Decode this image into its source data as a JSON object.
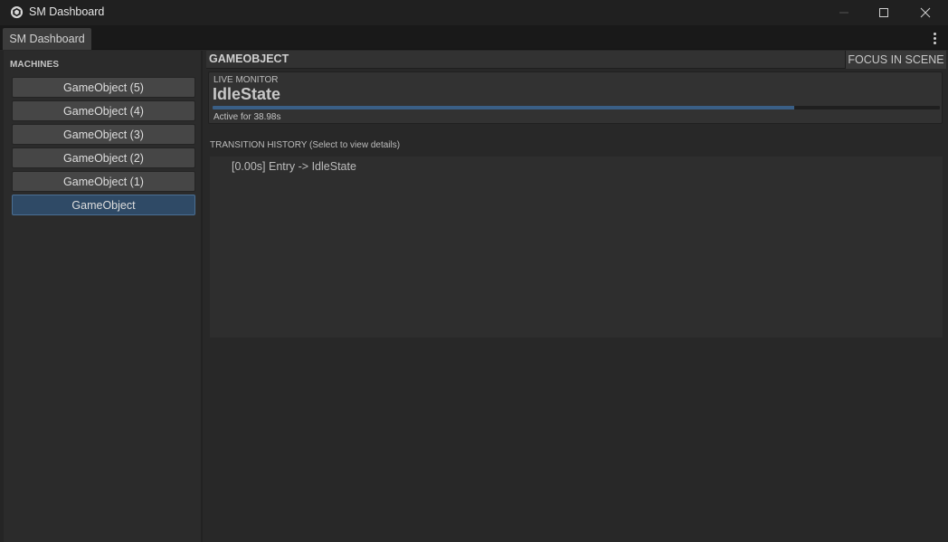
{
  "window": {
    "title": "SM Dashboard"
  },
  "tab": {
    "label": "SM Dashboard"
  },
  "sidebar": {
    "title": "MACHINES",
    "machines": [
      {
        "label": "GameObject (5)",
        "selected": false
      },
      {
        "label": "GameObject (4)",
        "selected": false
      },
      {
        "label": "GameObject (3)",
        "selected": false
      },
      {
        "label": "GameObject (2)",
        "selected": false
      },
      {
        "label": "GameObject (1)",
        "selected": false
      },
      {
        "label": "GameObject",
        "selected": true
      }
    ]
  },
  "main": {
    "header_title": "GAMEOBJECT",
    "focus_button": "FOCUS IN SCENE",
    "live_monitor": {
      "label": "LIVE MONITOR",
      "state": "IdleState",
      "progress_fraction": 0.8,
      "active_text": "Active for 38.98s"
    },
    "history": {
      "title": "TRANSITION HISTORY (Select to view details)",
      "items": [
        "[0.00s] Entry -> IdleState"
      ]
    }
  },
  "colors": {
    "selected_bg": "#2f4a66",
    "progress": "#3a5f86"
  }
}
